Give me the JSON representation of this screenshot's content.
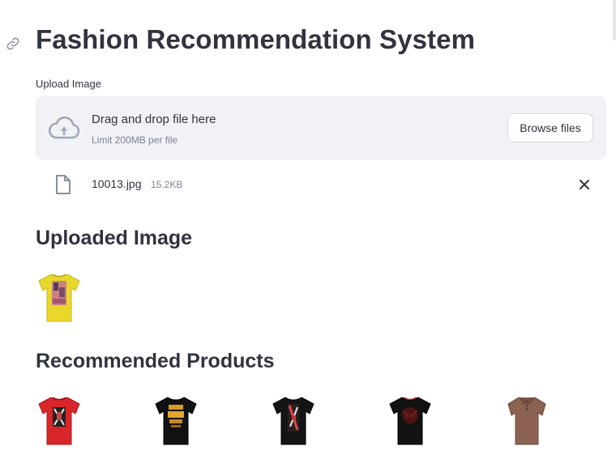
{
  "app": {
    "title": "Fashion Recommendation System"
  },
  "uploader": {
    "label": "Upload Image",
    "drop_text": "Drag and drop file here",
    "limit_text": "Limit 200MB per file",
    "browse_label": "Browse files",
    "file": {
      "name": "10013.jpg",
      "size": "15.2KB"
    }
  },
  "sections": {
    "uploaded_heading": "Uploaded Image",
    "recommended_heading": "Recommended Products"
  },
  "uploaded_image": {
    "item": "yellow t-shirt with graphic print",
    "color": "#e8d82a"
  },
  "recommended": [
    {
      "item": "red t-shirt with graphic print",
      "color": "#d9262a"
    },
    {
      "item": "black t-shirt with orange text print",
      "color": "#111111"
    },
    {
      "item": "black t-shirt with red graphic print",
      "color": "#141414"
    },
    {
      "item": "black t-shirt with dark red print",
      "color": "#121212"
    },
    {
      "item": "brown polo shirt",
      "color": "#8b6251"
    }
  ],
  "icons": {
    "anchor": "link-icon",
    "upload": "cloud-upload-icon",
    "file": "file-icon",
    "remove": "close-icon"
  }
}
